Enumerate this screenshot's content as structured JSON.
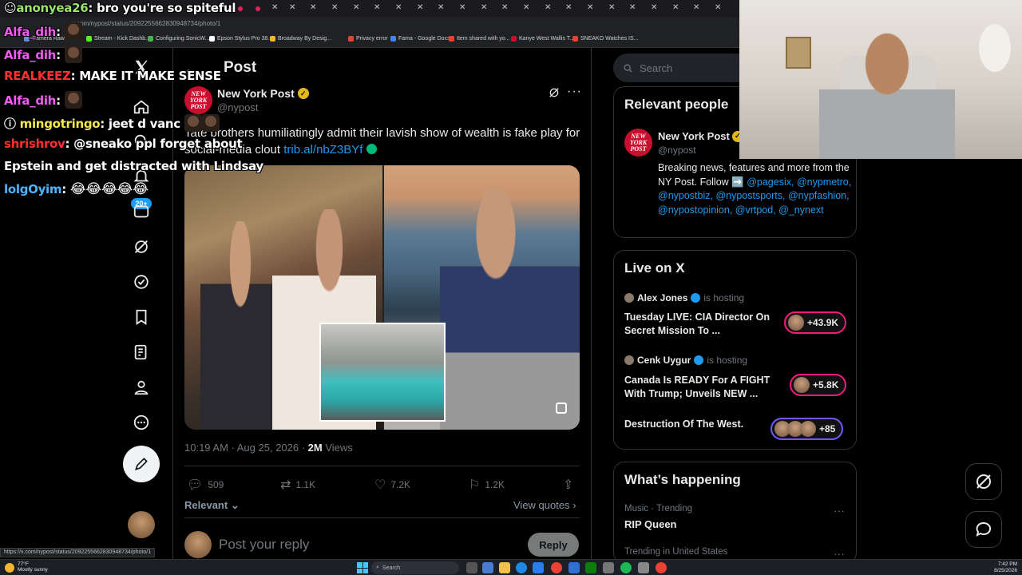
{
  "browser": {
    "url": "x.com/nypost/status/2092255662830948734/photo/1",
    "status_url": "https://x.com/nypost/status/2092255662830948734/photo/1",
    "bookmarks": [
      "Camera Raw",
      "Stream - Kick Dashb...",
      "Configuring SonicW...",
      "Epson Stylus Pro 38...",
      "Broadway By Desig...",
      "Privacy error",
      "Fama - Google Docs",
      "Item shared with yo...",
      "Kanye West Wallis T...",
      "SNEAKO Watches IS..."
    ]
  },
  "chat": [
    {
      "user": "anonyea26",
      "user_color": "#9be36b",
      "message": "bro you're so spiteful",
      "emote": false
    },
    {
      "user": "Alfa_dih",
      "user_color": "#f05cf0",
      "message": "",
      "emote": true
    },
    {
      "user": "Alfa_dih",
      "user_color": "#f05cf0",
      "message": "",
      "emote": true
    },
    {
      "user": "REALKEEZ",
      "user_color": "#ff3030",
      "message": "MAKE IT MAKE SENSE",
      "emote": false
    },
    {
      "user": "Alfa_dih",
      "user_color": "#f05cf0",
      "message": "",
      "emote": true
    },
    {
      "user": "mingotringo",
      "user_color": "#f5e94a",
      "message": "jeet d vanc",
      "emote": false
    },
    {
      "user": "shrishrov",
      "user_color": "#ff3030",
      "message": "@sneako ppl forget about",
      "emote": false
    },
    {
      "user": "",
      "user_color": "#ffffff",
      "message": "Epstein and get distracted with Lindsay",
      "emote": false
    },
    {
      "user": "lolgOyim",
      "user_color": "#4fb4ff",
      "message": "😂😂😂😂😂",
      "emote": false
    }
  ],
  "nav": {
    "badge": "20+",
    "items": [
      "x-logo",
      "home",
      "explore",
      "notifications",
      "messages",
      "grok",
      "premium",
      "bookmarks",
      "communities",
      "profile",
      "more"
    ]
  },
  "post": {
    "header_title": "Post",
    "author_name": "New York Post",
    "author_handle": "@nypost",
    "logo_text": "NEW YORK POST",
    "text": "Tate brothers humiliatingly admit their lavish show of wealth is fake play for social-media clout",
    "link": "trib.al/nbZ3BYf",
    "time": "10:19 AM · Aug 25, 2026 · ",
    "views_count": "2M",
    "views_label": "Views",
    "stats": {
      "replies": "509",
      "reposts": "1.1K",
      "likes": "7.2K",
      "bookmarks": "1.2K"
    },
    "relevant": "Relevant",
    "view_quotes": "View quotes",
    "reply_placeholder": "Post your reply",
    "reply_button": "Reply"
  },
  "sidebar": {
    "search_placeholder": "Search",
    "relevant_people": {
      "title": "Relevant people",
      "name": "New York Post",
      "handle": "@nypost",
      "bio": "Breaking news, features and more from the NY Post. Follow ➡️",
      "bio_links": "@pagesix, @nypmetro, @nypostbiz, @nypostsports, @nypfashion, @nypostopinion, @vrtpod, @_nynext"
    },
    "live": {
      "title": "Live on X",
      "items": [
        {
          "host": "Alex Jones",
          "status": "is hosting",
          "title": "Tuesday LIVE: CIA Director On Secret Mission To ...",
          "count": "+43.9K"
        },
        {
          "host": "Cenk Uygur",
          "status": "is hosting",
          "title": "Canada Is READY For A FIGHT With Trump; Unveils NEW ...",
          "count": "+5.8K"
        },
        {
          "host": "",
          "status": "",
          "title": "Destruction Of The West.",
          "count": "+85"
        }
      ]
    },
    "happening": {
      "title": "What’s happening",
      "trends": [
        {
          "meta": "Music · Trending",
          "name": "RIP Queen"
        },
        {
          "meta": "Trending in United States",
          "name": ""
        }
      ]
    }
  },
  "taskbar": {
    "weather_temp": "77°F",
    "weather_desc": "Mostly sunny",
    "search_label": "Search",
    "time": "7:42 PM",
    "date": "8/25/2026"
  },
  "colors": {
    "accent": "#1d9bf0",
    "live_pill": "#f91880",
    "live_pill_alt": "#7856ff",
    "verified_gold": "#e2b719",
    "link_green": "#00ba7c"
  }
}
